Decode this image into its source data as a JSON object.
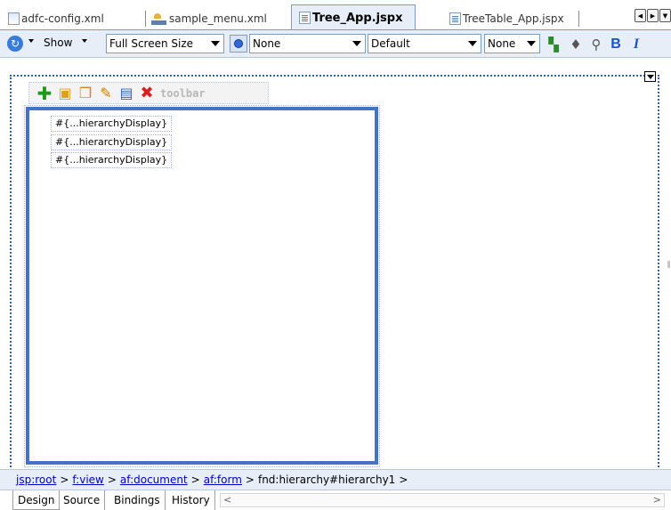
{
  "tabs": [
    {
      "label": "adfc-config.xml",
      "icon": "xml-file-icon",
      "active": false
    },
    {
      "label": "sample_menu.xml",
      "icon": "menu-file-icon",
      "active": false
    },
    {
      "label": "Tree_App.jspx",
      "icon": "jspx-file-icon",
      "active": true
    },
    {
      "label": "TreeTable_App.jspx",
      "icon": "jspx-file-icon",
      "active": false
    }
  ],
  "toolbar": {
    "show_label": "Show",
    "screen_size": "Full Screen Size",
    "stylesheet": "None",
    "style_class": "Default",
    "font": "None",
    "bold_label": "B"
  },
  "component_toolbar": {
    "label": "toolbar",
    "icons": [
      "add-icon",
      "new-folder-icon",
      "duplicate-icon",
      "edit-icon",
      "delete-icon",
      "remove-icon"
    ]
  },
  "tree": {
    "nodes": [
      "#{...hierarchyDisplay}",
      "#{...hierarchyDisplay}",
      "#{...hierarchyDisplay}"
    ]
  },
  "breadcrumb": {
    "links": [
      "jsp:root",
      "f:view",
      "af:document",
      "af:form"
    ],
    "current": "fnd:hierarchy#hierarchy1",
    "separator": ">"
  },
  "bottom_tabs": [
    "Design",
    "Source",
    "Bindings",
    "History"
  ],
  "colors": {
    "accent": "#4472c4",
    "toolbar_bg": "#e7eef8",
    "link": "#0000cc"
  }
}
